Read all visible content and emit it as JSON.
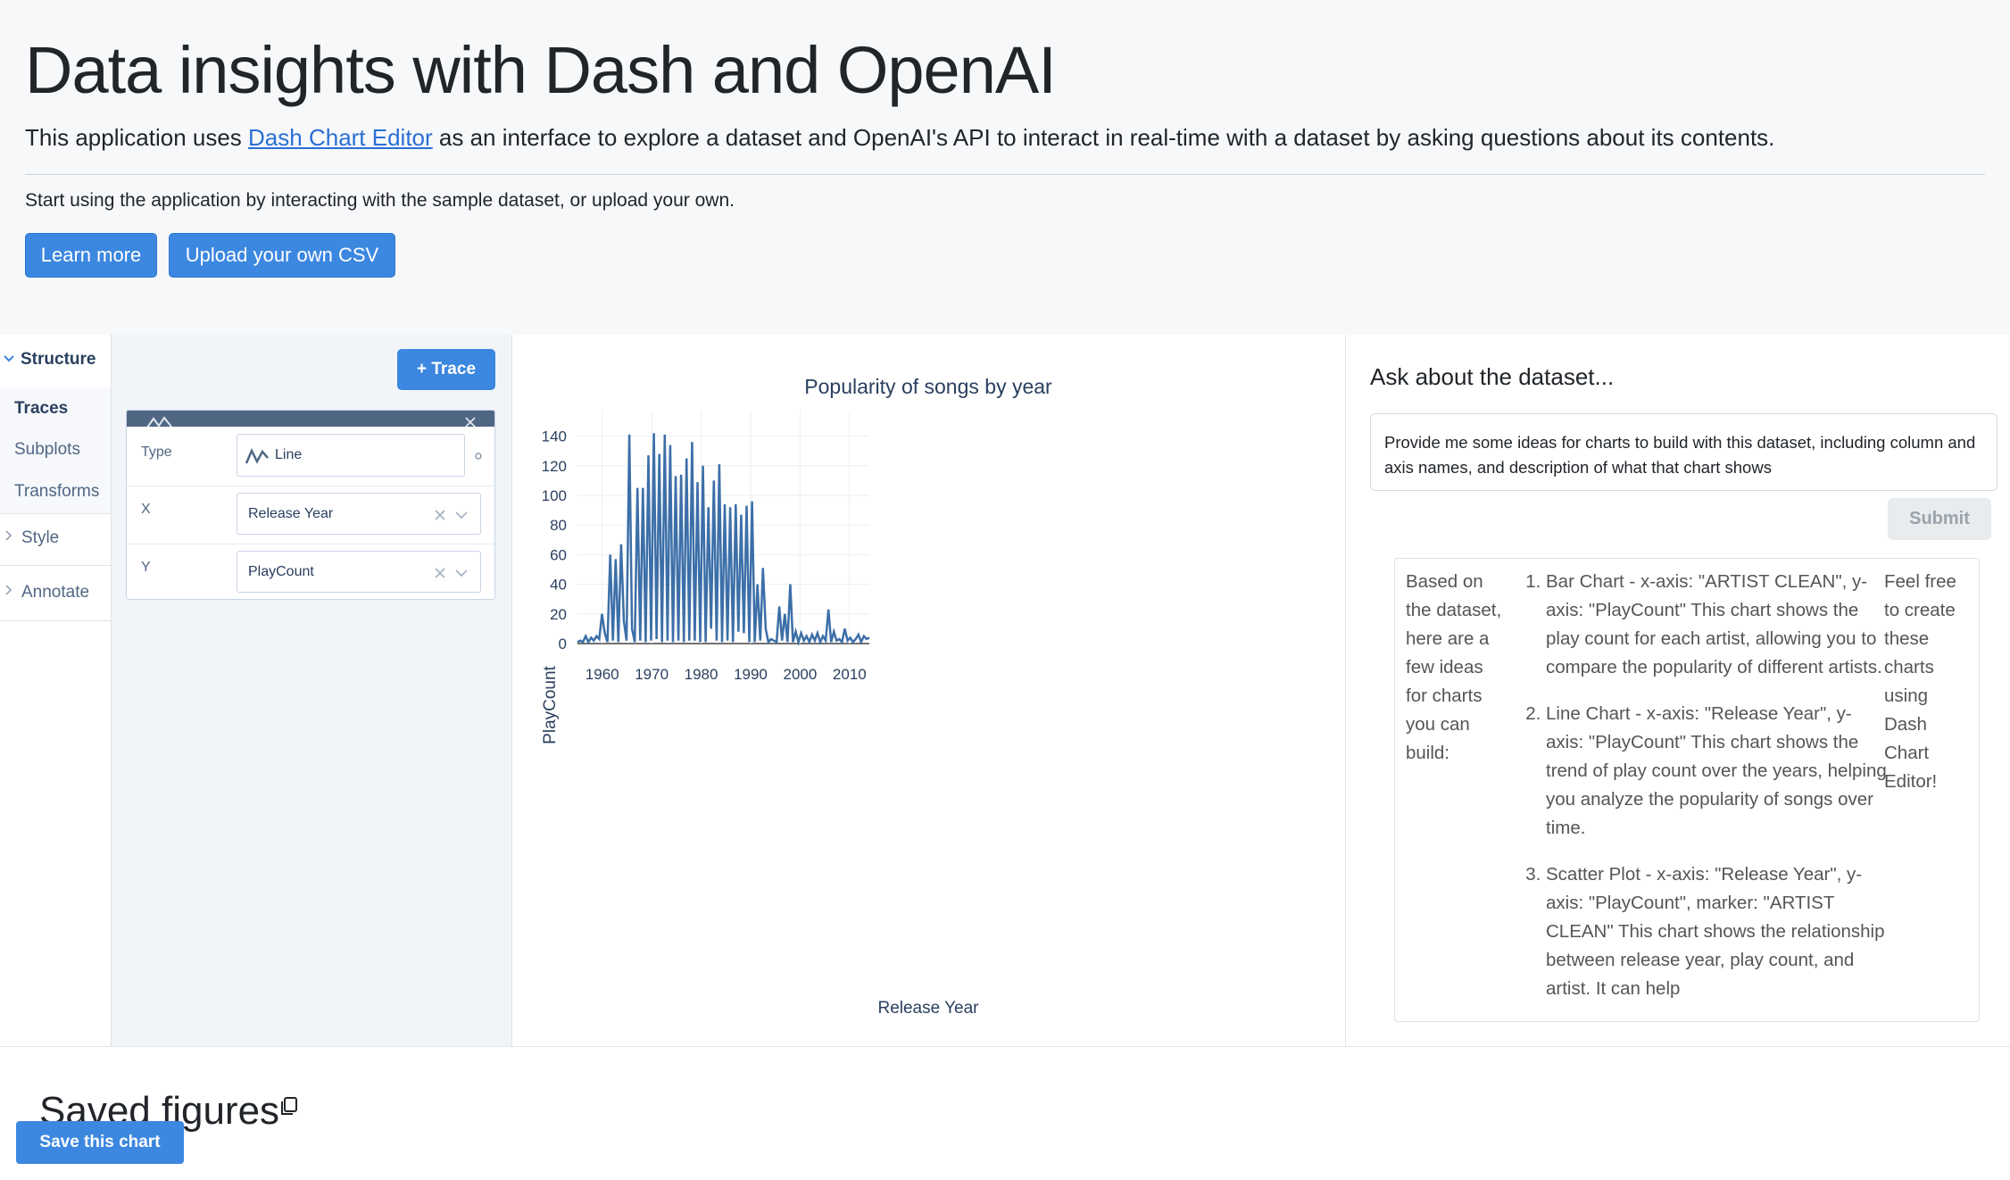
{
  "header": {
    "title": "Data insights with Dash and OpenAI",
    "lead_before": "This application uses ",
    "lead_link": "Dash Chart Editor",
    "lead_after": " as an interface to explore a dataset and OpenAI's API to interact in real-time with a dataset by asking questions about its contents.",
    "subtext": "Start using the application by interacting with the sample dataset, or upload your own.",
    "learn_more": "Learn more",
    "upload": "Upload your own CSV"
  },
  "editor": {
    "nav": {
      "structure": "Structure",
      "traces": "Traces",
      "subplots": "Subplots",
      "transforms": "Transforms",
      "style": "Style",
      "annotate": "Annotate"
    },
    "trace_button": "+ Trace",
    "trace": {
      "type_label": "Type",
      "type_value": "Line",
      "x_label": "X",
      "x_value": "Release Year",
      "y_label": "Y",
      "y_value": "PlayCount"
    }
  },
  "chart_data": {
    "type": "line",
    "title": "Popularity of songs by year",
    "xlabel": "Release Year",
    "ylabel": "PlayCount",
    "xlim": [
      1955,
      2014
    ],
    "ylim": [
      0,
      150
    ],
    "xticks": [
      1960,
      1970,
      1980,
      1990,
      2000,
      2010
    ],
    "yticks": [
      0,
      20,
      40,
      60,
      80,
      100,
      120,
      140
    ],
    "grid": true,
    "color": "#3c6fa8",
    "x": [
      1955,
      1958,
      1961,
      1962,
      1963,
      1963.5,
      1964,
      1964.5,
      1965,
      1966,
      1966.4,
      1966.8,
      1967.6,
      1968,
      1969,
      1970,
      1970.7,
      1971.4,
      1972,
      1972.5,
      1973,
      1973.7,
      1974,
      1975,
      1975.6,
      1976,
      1976.5,
      1977,
      1977.5,
      1978,
      1978.5,
      1979,
      1979.5,
      1980,
      1980.5,
      1981,
      1981.5,
      1982,
      1982.5,
      1983,
      1983.5,
      1984,
      1984.5,
      1985,
      1985.5,
      1986,
      1986.5,
      1987,
      1987.5,
      1988,
      1988.5,
      1989,
      1989.5,
      1990,
      1991,
      1991.5,
      1992,
      1992.5,
      1993,
      1993.5,
      1994,
      1994.5,
      1995,
      1995.5,
      1996,
      1996.5,
      1997,
      1997.5,
      1998,
      1999,
      1999.5,
      2000,
      2000.5,
      2001,
      2002,
      2002.5,
      2003,
      2003.5,
      2004,
      2005,
      2006,
      2007,
      2008,
      2009,
      2010,
      2011,
      2011.5,
      2012,
      2012.5,
      2013,
      2014
    ],
    "values": [
      1,
      2,
      1,
      5,
      1,
      4,
      2,
      5,
      3,
      20,
      7,
      1,
      60,
      2,
      57,
      1,
      67,
      15,
      2,
      141,
      10,
      1,
      105,
      2,
      105,
      1,
      127,
      2,
      142,
      3,
      128,
      1,
      141,
      2,
      134,
      1,
      113,
      2,
      114,
      1,
      125,
      2,
      136,
      2,
      109,
      1,
      120,
      1,
      92,
      10,
      110,
      2,
      121,
      1,
      94,
      2,
      92,
      1,
      94,
      8,
      87,
      7,
      93,
      1,
      96,
      1,
      40,
      2,
      51,
      10,
      1,
      3,
      2,
      1,
      25,
      2,
      20,
      1,
      40,
      1,
      8,
      1,
      7,
      2,
      5,
      1,
      6,
      2,
      7,
      1,
      5,
      2,
      23,
      1,
      8,
      2,
      3,
      1,
      10,
      2,
      4,
      1,
      3,
      6,
      1,
      5,
      3,
      4
    ]
  },
  "chat": {
    "title": "Ask about the dataset...",
    "prompt": "Provide me some ideas for charts to build with this dataset, including column and axis names, and description of what that chart shows",
    "submit": "Submit",
    "answer_intro": "Based on the dataset, here are a few ideas for charts you can build:",
    "answer_items": [
      "Bar Chart - x-axis: \"ARTIST CLEAN\", y-axis: \"PlayCount\" This chart shows the play count for each artist, allowing you to compare the popularity of different artists.",
      "Line Chart - x-axis: \"Release Year\", y-axis: \"PlayCount\" This chart shows the trend of play count over the years, helping you analyze the popularity of songs over time.",
      "Scatter Plot - x-axis: \"Release Year\", y-axis: \"PlayCount\", marker: \"ARTIST CLEAN\" This chart shows the relationship between release year, play count, and artist. It can help"
    ],
    "answer_outro": "Feel free to create these charts using Dash Chart Editor!"
  },
  "saved": {
    "title": "Saved figures",
    "save_button": "Save this chart"
  }
}
